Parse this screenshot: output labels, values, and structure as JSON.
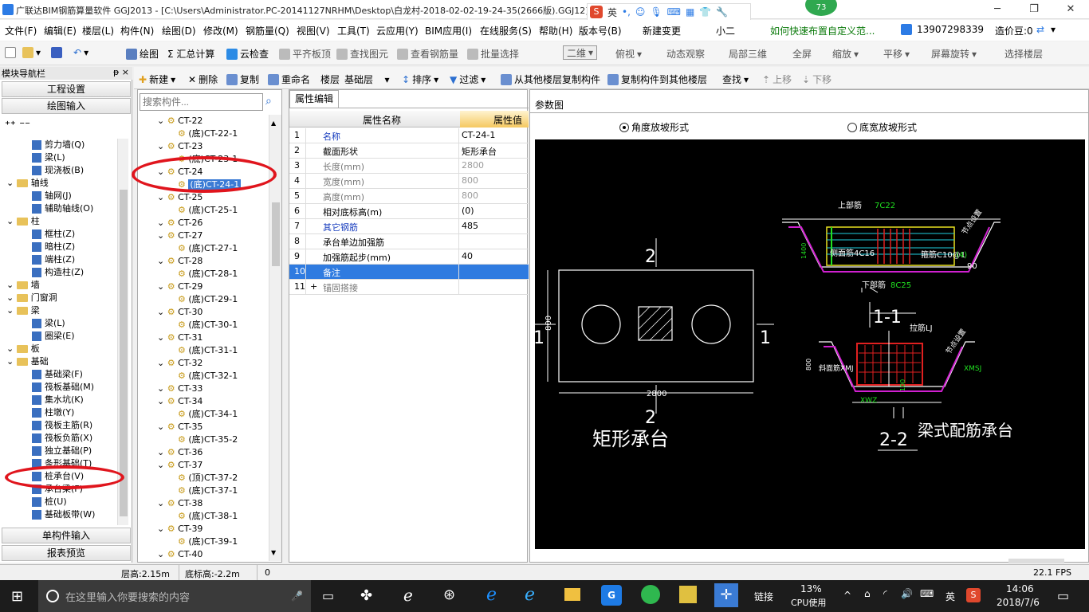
{
  "app": {
    "title": "广联达BIM钢筋算量软件 GGJ2013 - [C:\\Users\\Administrator.PC-20141127NRHM\\Desktop\\白龙村-2018-02-02-19-24-35(2666版).GGJ12]",
    "badge": "73",
    "ime": "英",
    "ask": "如何快速布置自定义范...",
    "phone": "13907298339",
    "bean": "造价豆:0"
  },
  "menu": [
    "文件(F)",
    "编辑(E)",
    "楼层(L)",
    "构件(N)",
    "绘图(D)",
    "修改(M)",
    "钢筋量(Q)",
    "视图(V)",
    "工具(T)",
    "云应用(Y)",
    "BIM应用(I)",
    "在线服务(S)",
    "帮助(H)",
    "版本号(B)",
    "新建变更",
    "小二"
  ],
  "toolbar1": [
    "绘图",
    "Σ 汇总计算",
    "云检查",
    "平齐板顶",
    "查找图元",
    "查看钢筋量",
    "批量选择",
    "二维",
    "俯视",
    "动态观察",
    "局部三维",
    "全屏",
    "缩放",
    "平移",
    "屏幕旋转",
    "选择楼层"
  ],
  "toolbar2": [
    "新建",
    "删除",
    "复制",
    "重命名",
    "楼层",
    "基础层",
    "排序",
    "过滤",
    "从其他楼层复制构件",
    "复制构件到其他楼层",
    "查找",
    "上移",
    "下移"
  ],
  "nav": {
    "header": "模块导航栏",
    "pin": "ᵽ ×",
    "top_buttons": [
      "工程设置",
      "绘图输入"
    ],
    "bottom_buttons": [
      "单构件输入",
      "报表预览"
    ],
    "items": [
      {
        "label": "剪力墙(Q)",
        "type": "el",
        "indent": 2
      },
      {
        "label": "梁(L)",
        "type": "el",
        "indent": 2
      },
      {
        "label": "现浇板(B)",
        "type": "el",
        "indent": 2
      },
      {
        "label": "轴线",
        "type": "folder",
        "indent": 0
      },
      {
        "label": "轴网(J)",
        "type": "el",
        "indent": 2
      },
      {
        "label": "辅助轴线(O)",
        "type": "el",
        "indent": 2
      },
      {
        "label": "柱",
        "type": "folder",
        "indent": 0
      },
      {
        "label": "框柱(Z)",
        "type": "el",
        "indent": 2
      },
      {
        "label": "暗柱(Z)",
        "type": "el",
        "indent": 2
      },
      {
        "label": "端柱(Z)",
        "type": "el",
        "indent": 2
      },
      {
        "label": "构造柱(Z)",
        "type": "el",
        "indent": 2
      },
      {
        "label": "墙",
        "type": "folder",
        "indent": 0
      },
      {
        "label": "门窗洞",
        "type": "folder",
        "indent": 0
      },
      {
        "label": "梁",
        "type": "folder",
        "indent": 0
      },
      {
        "label": "梁(L)",
        "type": "el",
        "indent": 2
      },
      {
        "label": "圈梁(E)",
        "type": "el",
        "indent": 2
      },
      {
        "label": "板",
        "type": "folder",
        "indent": 0
      },
      {
        "label": "基础",
        "type": "folder",
        "indent": 0
      },
      {
        "label": "基础梁(F)",
        "type": "el",
        "indent": 2
      },
      {
        "label": "筏板基础(M)",
        "type": "el",
        "indent": 2
      },
      {
        "label": "集水坑(K)",
        "type": "el",
        "indent": 2
      },
      {
        "label": "柱墩(Y)",
        "type": "el",
        "indent": 2
      },
      {
        "label": "筏板主筋(R)",
        "type": "el",
        "indent": 2
      },
      {
        "label": "筏板负筋(X)",
        "type": "el",
        "indent": 2
      },
      {
        "label": "独立基础(P)",
        "type": "el",
        "indent": 2
      },
      {
        "label": "条形基础(T)",
        "type": "el",
        "indent": 2
      },
      {
        "label": "桩承台(V)",
        "type": "el",
        "indent": 2
      },
      {
        "label": "承台梁(F)",
        "type": "el",
        "indent": 2
      },
      {
        "label": "桩(U)",
        "type": "el",
        "indent": 2
      },
      {
        "label": "基础板带(W)",
        "type": "el",
        "indent": 2
      }
    ]
  },
  "comp": {
    "search_placeholder": "搜索构件...",
    "items": [
      "CT-22",
      "(底)CT-22-1",
      "CT-23",
      "(底)CT-23-1",
      "CT-24",
      "(底)CT-24-1",
      "CT-25",
      "(底)CT-25-1",
      "CT-26",
      "CT-27",
      "(底)CT-27-1",
      "CT-28",
      "(底)CT-28-1",
      "CT-29",
      "(底)CT-29-1",
      "CT-30",
      "(底)CT-30-1",
      "CT-31",
      "(底)CT-31-1",
      "CT-32",
      "(底)CT-32-1",
      "CT-33",
      "CT-34",
      "(底)CT-34-1",
      "CT-35",
      "(底)CT-35-2",
      "CT-36",
      "CT-37",
      "(顶)CT-37-2",
      "(底)CT-37-1",
      "CT-38",
      "(底)CT-38-1",
      "CT-39",
      "(底)CT-39-1",
      "CT-40"
    ]
  },
  "prop": {
    "tab": "属性编辑",
    "col_name": "属性名称",
    "col_val": "属性值",
    "rows": [
      {
        "n": "1",
        "name": "名称",
        "val": "CT-24-1",
        "blue": true
      },
      {
        "n": "2",
        "name": "截面形状",
        "val": "矩形承台"
      },
      {
        "n": "3",
        "name": "长度(mm)",
        "val": "2800",
        "grey": true
      },
      {
        "n": "4",
        "name": "宽度(mm)",
        "val": "800",
        "grey": true
      },
      {
        "n": "5",
        "name": "高度(mm)",
        "val": "800",
        "grey": true
      },
      {
        "n": "6",
        "name": "相对底标高(m)",
        "val": "(0)"
      },
      {
        "n": "7",
        "name": "其它钢筋",
        "val": "485",
        "blue": true
      },
      {
        "n": "8",
        "name": "承台单边加强筋",
        "val": ""
      },
      {
        "n": "9",
        "name": "加强筋起步(mm)",
        "val": "40"
      },
      {
        "n": "10",
        "name": "备注",
        "val": "",
        "selected": true
      },
      {
        "n": "11",
        "name": "锚固搭接",
        "val": "",
        "grey": true,
        "expand": "+"
      }
    ]
  },
  "param": {
    "title": "参数图",
    "opt1": "角度放坡形式",
    "opt2": "底宽放坡形式",
    "drawing": {
      "sec_top": "2",
      "sec_left": "1",
      "sec_right": "1",
      "sec_bottom": "2",
      "dim_h": "800",
      "dim_w": "2800",
      "left_title": "矩形承台",
      "s11": "1-1",
      "s22": "2-2",
      "right_title": "梁式配筋承台",
      "top_bar": "上部筋",
      "top_bar_val": "7C22",
      "side_bar": "侧面筋4C16",
      "stir": "箍筋C10@1",
      "stir2": "(4)",
      "bot_bar": "下部筋",
      "bot_bar_val": "8C25",
      "angle": "90",
      "slope": "节点设置",
      "h1": "1400",
      "lj": "拉筋LJ",
      "xmj": "斜面筋XMJ",
      "xmsj": "XMSJ",
      "xwz": "XWZ",
      "h2": "800",
      "h3": "100"
    }
  },
  "status": {
    "floor_h": "层高:2.15m",
    "bottom_h": "底标高:-2.2m",
    "zero": "0",
    "fps": "22.1 FPS"
  },
  "taskbar": {
    "search": "在这里输入你要搜索的内容",
    "link": "链接",
    "cpu": "13%",
    "cpu_label": "CPU使用",
    "ime": "英",
    "time": "14:06",
    "date": "2018/7/6"
  }
}
